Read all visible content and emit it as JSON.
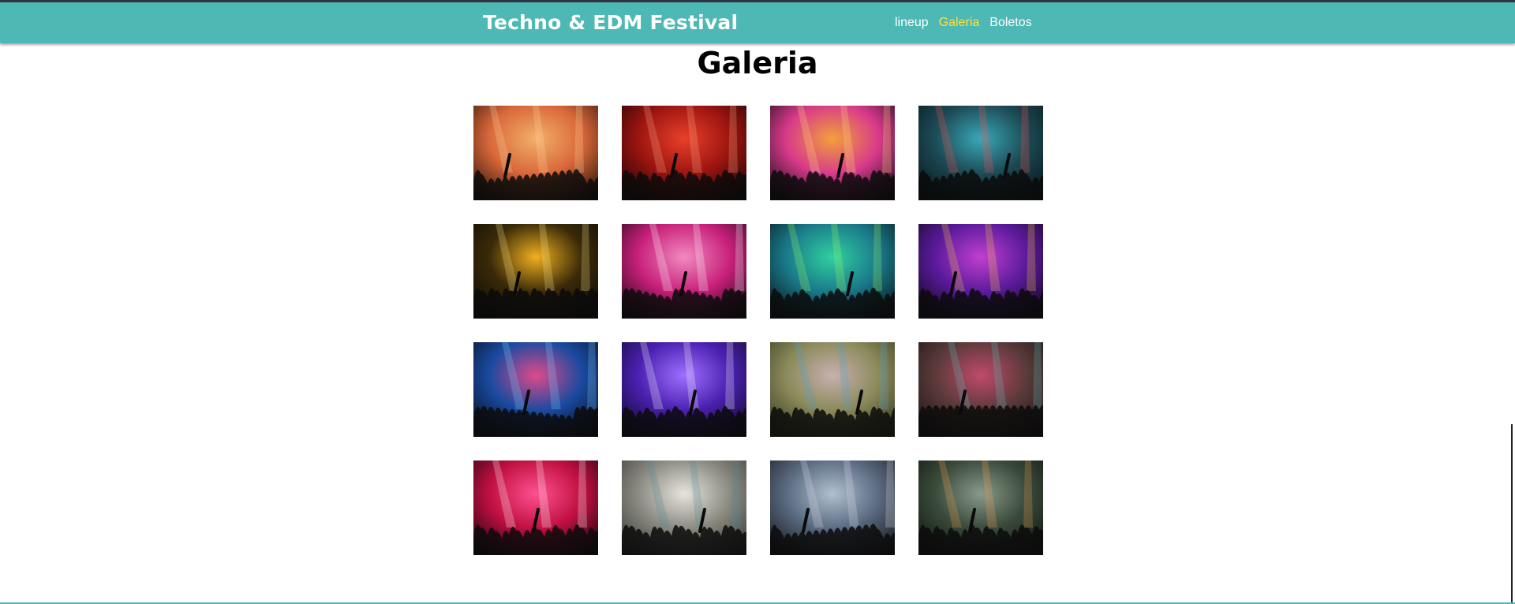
{
  "header": {
    "brand": "Techno & EDM Festival",
    "nav": [
      {
        "label": "lineup",
        "active": false
      },
      {
        "label": "Galeria",
        "active": true
      },
      {
        "label": "Boletos",
        "active": false
      }
    ]
  },
  "main": {
    "title": "Galeria"
  },
  "colors": {
    "navbar": "#4db8b4",
    "active_link": "#ffe23a",
    "link": "#ffffff"
  },
  "gallery": {
    "images": [
      {
        "name": "sunset-crowd-photo",
        "theme": [
          "#2a1208",
          "#d9683a",
          "#f2b06a"
        ],
        "accent": "#ffd8a0"
      },
      {
        "name": "red-dancer-photo",
        "theme": [
          "#180404",
          "#9c1410",
          "#e8402a"
        ],
        "accent": "#ffb08a"
      },
      {
        "name": "phone-recording-photo",
        "theme": [
          "#150a1a",
          "#d83a8a",
          "#f2a03a"
        ],
        "accent": "#ffe080"
      },
      {
        "name": "dj-silhouette-photo",
        "theme": [
          "#0a1418",
          "#1c4a55",
          "#3aa8b8"
        ],
        "accent": "#ff5050"
      },
      {
        "name": "yellow-stage-photo",
        "theme": [
          "#0a0a08",
          "#3a2a08",
          "#f0b020"
        ],
        "accent": "#ffe890"
      },
      {
        "name": "confetti-crowd-photo",
        "theme": [
          "#200818",
          "#c8207a",
          "#f08ac0"
        ],
        "accent": "#ffffff"
      },
      {
        "name": "green-lasers-photo",
        "theme": [
          "#08141c",
          "#1a7a8a",
          "#30d0a0"
        ],
        "accent": "#a0ff60"
      },
      {
        "name": "purple-stage-photo",
        "theme": [
          "#10081c",
          "#5a1a9a",
          "#c040d0"
        ],
        "accent": "#ffd040"
      },
      {
        "name": "blue-concert-photo",
        "theme": [
          "#060c1c",
          "#1a4aa0",
          "#e04a8a"
        ],
        "accent": "#80d0ff"
      },
      {
        "name": "smiling-woman-photo",
        "theme": [
          "#10082a",
          "#4a20b0",
          "#a070ff"
        ],
        "accent": "#ffffff"
      },
      {
        "name": "field-festival-photo",
        "theme": [
          "#3a3a20",
          "#8a8a5a",
          "#c8b0b0"
        ],
        "accent": "#50a0d0"
      },
      {
        "name": "pink-haze-stage-photo",
        "theme": [
          "#1a1414",
          "#5a3a3a",
          "#c04a6a"
        ],
        "accent": "#60c0c0"
      },
      {
        "name": "red-laser-photo",
        "theme": [
          "#1a0410",
          "#c01040",
          "#ff5090"
        ],
        "accent": "#ffffff"
      },
      {
        "name": "outdoor-crowd-photo",
        "theme": [
          "#3a3a3a",
          "#8a8a80",
          "#e8e4dc"
        ],
        "accent": "#4a8a9a"
      },
      {
        "name": "dj-tents-photo",
        "theme": [
          "#1a1a20",
          "#5a6a80",
          "#b0c0d0"
        ],
        "accent": "#e0e0f0"
      },
      {
        "name": "night-field-photo",
        "theme": [
          "#101410",
          "#3a4a3a",
          "#8a9a8a"
        ],
        "accent": "#f0a050"
      }
    ]
  }
}
